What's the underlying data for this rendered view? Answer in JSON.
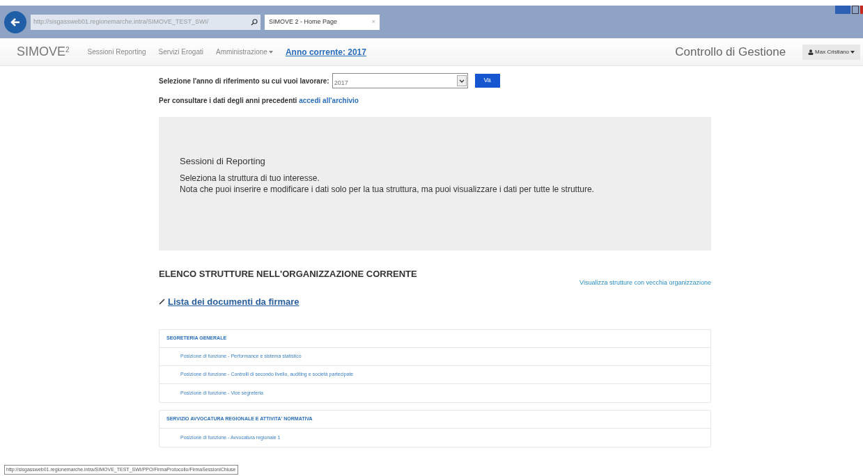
{
  "browser": {
    "address": "http://sisgassweb01.regionemarche.intra/SIMOVE_TEST_SWI/",
    "tab_title": "SIMOVE 2 - Home Page",
    "tab_close": "×"
  },
  "navbar": {
    "brand": "SIMOVE",
    "brand_sup": "2",
    "items": [
      {
        "label": "Sessioni Reporting",
        "kind": "link"
      },
      {
        "label": "Servizi Erogati",
        "kind": "link"
      },
      {
        "label": "Amministrazione",
        "kind": "dropdown"
      },
      {
        "label": "Anno corrente: 2017",
        "kind": "highlight"
      }
    ],
    "app_title": "Controllo di Gestione",
    "user": "Max Cristiano"
  },
  "year_select": {
    "label": "Selezione l'anno di riferimento su cui vuoi lavorare:",
    "value": "2017",
    "button": "Va"
  },
  "archive": {
    "text": "Per consultare i dati degli anni precedenti",
    "link": "accedi all'archivio"
  },
  "panel": {
    "title": "Sessioni di Reporting",
    "lines": [
      "Seleziona la struttura di tuo interesse.",
      "Nota che puoi inserire e modificare i dati solo per la tua struttura, ma puoi visualizzare i dati per tutte le strutture."
    ]
  },
  "section_title": "ELENCO STRUTTURE NELL'ORGANIZZAZIONE CORRENTE",
  "old_org_link": "Visualizza strutture con vecchia organizzazione",
  "documents_link": "Lista dei documenti da firmare",
  "groups": [
    {
      "title": "SEGRETERIA GENERALE",
      "items": [
        "Posizione di funzione - Performance e sistema statistico",
        "Posizione di funzione - Controlli di secondo livello, auditing e società partecipate",
        "Posizione di funzione - Vice segreteria"
      ]
    },
    {
      "title": "SERVIZIO AVVOCATURA REGIONALE E ATTIVITA' NORMATIVA",
      "items": [
        "Posizione di funzione - Avvocatura regionale 1"
      ]
    }
  ],
  "status_bar": "http://sisgassweb01.regionemarche.intra/SIMOVE_TEST_SWI/PPO/FirmaProtocollo/FirmaSessioniChiuse"
}
